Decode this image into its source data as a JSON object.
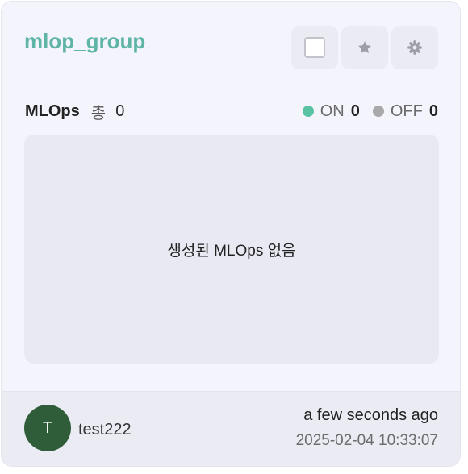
{
  "card": {
    "title": "mlop_group",
    "stats": {
      "label": "MLOps",
      "total_label": "총",
      "total_value": "0",
      "on_label": "ON",
      "on_value": "0",
      "off_label": "OFF",
      "off_value": "0"
    },
    "empty_message": "생성된 MLOps 없음",
    "footer": {
      "avatar_initial": "T",
      "user_name": "test222",
      "time_relative": "a few seconds ago",
      "time_absolute": "2025-02-04 10:33:07"
    }
  },
  "icons": {
    "select": "checkbox-icon",
    "favorite": "star-icon",
    "settings": "gear-icon"
  },
  "colors": {
    "title": "#5fb5a5",
    "on_dot": "#58c3a2",
    "off_dot": "#a9a9a9",
    "avatar": "#2f5d3a"
  }
}
